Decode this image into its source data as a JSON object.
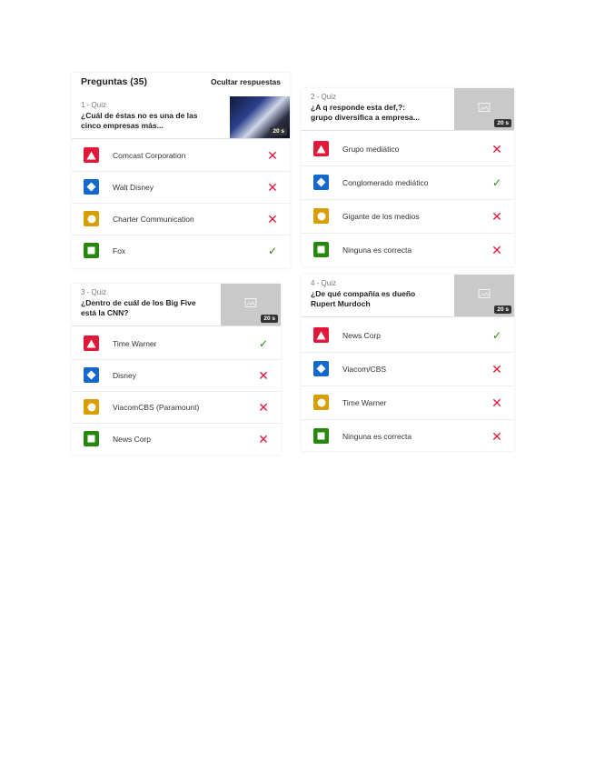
{
  "header": {
    "title": "Preguntas (35)",
    "hide_answers": "Ocultar respuestas"
  },
  "colors": {
    "red": "#e2173a",
    "blue": "#1368ce",
    "yellow": "#d89e00",
    "green": "#26890c"
  },
  "questions": [
    {
      "number": "1 - Quiz",
      "text": "¿Cuál de éstas no es una de las cinco empresas más...",
      "time": "20 s",
      "thumbnail": "photo",
      "answers": [
        {
          "text": "Comcast Corporation",
          "correct": false
        },
        {
          "text": "Walt Disney",
          "correct": false
        },
        {
          "text": "Charter Communication",
          "correct": false
        },
        {
          "text": "Fox",
          "correct": true
        }
      ]
    },
    {
      "number": "2 - Quiz",
      "text": "¿A q responde esta def,?: grupo diversifica a empresa...",
      "time": "20 s",
      "thumbnail": "image-placeholder-icon",
      "answers": [
        {
          "text": "Grupo mediático",
          "correct": false
        },
        {
          "text": "Conglomerado mediático",
          "correct": true
        },
        {
          "text": "Gigante de los medios",
          "correct": false
        },
        {
          "text": "Ninguna es correcta",
          "correct": false
        }
      ]
    },
    {
      "number": "3 - Quiz",
      "text": "¿Dentro de cuál de los Big Five está la CNN?",
      "time": "20 s",
      "thumbnail": "image-placeholder-icon",
      "answers": [
        {
          "text": "Time Warner",
          "correct": true
        },
        {
          "text": "Disney",
          "correct": false
        },
        {
          "text": "ViacomCBS (Paramount)",
          "correct": false
        },
        {
          "text": "News Corp",
          "correct": false
        }
      ]
    },
    {
      "number": "4 - Quiz",
      "text": "¿De qué compañía es dueño Rupert Murdoch",
      "time": "20 s",
      "thumbnail": "image-placeholder-icon",
      "answers": [
        {
          "text": "News Corp",
          "correct": true
        },
        {
          "text": "Viacom/CBS",
          "correct": false
        },
        {
          "text": "Time Warner",
          "correct": false
        },
        {
          "text": "Ninguna es correcta",
          "correct": false
        }
      ]
    }
  ],
  "icons": {
    "shapes": [
      "triangle-icon",
      "diamond-icon",
      "circle-icon",
      "square-icon"
    ],
    "wrong": "cross-icon",
    "right": "check-icon",
    "placeholder": "image-placeholder-icon"
  }
}
